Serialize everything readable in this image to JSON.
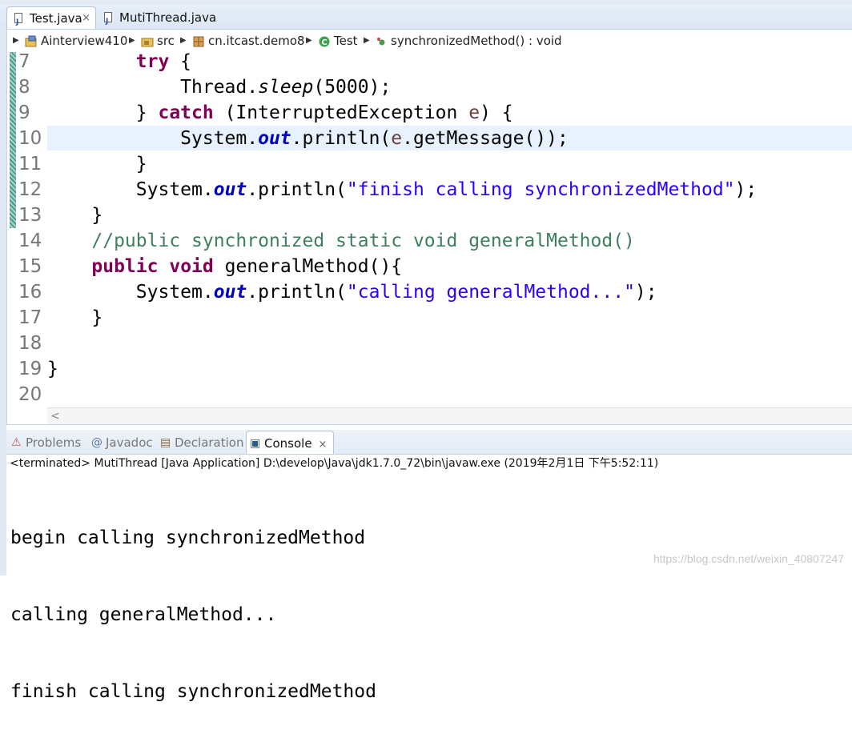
{
  "tabs": [
    {
      "label": "Test.java",
      "active": true,
      "closable": true
    },
    {
      "label": "MutiThread.java",
      "active": false,
      "closable": false
    }
  ],
  "close_glyph": "×",
  "breadcrumb": [
    {
      "label": "Ainterview410",
      "icon": "project-icon"
    },
    {
      "label": "src",
      "icon": "source-folder-icon"
    },
    {
      "label": "cn.itcast.demo8",
      "icon": "package-icon"
    },
    {
      "label": "Test",
      "icon": "class-icon"
    },
    {
      "label": "synchronizedMethod() : void",
      "icon": "method-icon"
    }
  ],
  "editor": {
    "highlighted_line": "10",
    "lines": [
      {
        "no": "7",
        "indent": "        ",
        "tokens": [
          {
            "t": "try",
            "c": "kw"
          },
          {
            "t": " {",
            "c": ""
          }
        ]
      },
      {
        "no": "8",
        "indent": "            ",
        "tokens": [
          {
            "t": "Thread.",
            "c": ""
          },
          {
            "t": "sleep",
            "c": "itl"
          },
          {
            "t": "(5000);",
            "c": ""
          }
        ]
      },
      {
        "no": "9",
        "indent": "        ",
        "tokens": [
          {
            "t": "} ",
            "c": ""
          },
          {
            "t": "catch",
            "c": "kw"
          },
          {
            "t": " (InterruptedException ",
            "c": ""
          },
          {
            "t": "e",
            "c": "var"
          },
          {
            "t": ") {",
            "c": ""
          }
        ]
      },
      {
        "no": "10",
        "indent": "            ",
        "tokens": [
          {
            "t": "System.",
            "c": ""
          },
          {
            "t": "out",
            "c": "fld"
          },
          {
            "t": ".println(",
            "c": ""
          },
          {
            "t": "e",
            "c": "var"
          },
          {
            "t": ".getMessage());",
            "c": ""
          }
        ]
      },
      {
        "no": "11",
        "indent": "        ",
        "tokens": [
          {
            "t": "}",
            "c": ""
          }
        ]
      },
      {
        "no": "12",
        "indent": "        ",
        "tokens": [
          {
            "t": "System.",
            "c": ""
          },
          {
            "t": "out",
            "c": "fld"
          },
          {
            "t": ".println(",
            "c": ""
          },
          {
            "t": "\"finish calling synchronizedMethod\"",
            "c": "str"
          },
          {
            "t": ");",
            "c": ""
          }
        ]
      },
      {
        "no": "13",
        "indent": "    ",
        "tokens": [
          {
            "t": "}",
            "c": ""
          }
        ]
      },
      {
        "no": "14",
        "indent": "    ",
        "tokens": [
          {
            "t": "//public synchronized static void generalMethod()",
            "c": "cmt"
          }
        ]
      },
      {
        "no": "15",
        "indent": "    ",
        "tokens": [
          {
            "t": "public",
            "c": "kw"
          },
          {
            "t": " ",
            "c": ""
          },
          {
            "t": "void",
            "c": "kw"
          },
          {
            "t": " generalMethod(){",
            "c": ""
          }
        ]
      },
      {
        "no": "16",
        "indent": "        ",
        "tokens": [
          {
            "t": "System.",
            "c": ""
          },
          {
            "t": "out",
            "c": "fld"
          },
          {
            "t": ".println(",
            "c": ""
          },
          {
            "t": "\"calling generalMethod...\"",
            "c": "str"
          },
          {
            "t": ");",
            "c": ""
          }
        ]
      },
      {
        "no": "17",
        "indent": "    ",
        "tokens": [
          {
            "t": "}",
            "c": ""
          }
        ]
      },
      {
        "no": "18",
        "indent": "",
        "tokens": []
      },
      {
        "no": "19",
        "indent": "",
        "tokens": [
          {
            "t": "}",
            "c": ""
          }
        ]
      },
      {
        "no": "20",
        "indent": "",
        "tokens": []
      }
    ]
  },
  "panel": {
    "tabs": [
      {
        "label": "Problems",
        "icon": "problems-icon",
        "active": false
      },
      {
        "label": "Javadoc",
        "icon": "javadoc-icon",
        "active": false
      },
      {
        "label": "Declaration",
        "icon": "declaration-icon",
        "active": false
      },
      {
        "label": "Console",
        "icon": "console-icon",
        "active": true
      }
    ],
    "status": "<terminated> MutiThread [Java Application] D:\\develop\\Java\\jdk1.7.0_72\\bin\\javaw.exe (2019年2月1日 下午5:52:11)",
    "output": [
      "begin calling synchronizedMethod",
      "calling generalMethod...",
      "finish calling synchronizedMethod"
    ]
  },
  "watermark": "https://blog.csdn.net/weixin_40807247",
  "colors": {
    "keyword": "#7f0055",
    "string": "#2a00ff",
    "comment": "#3f7f5f",
    "field": "#0000c0",
    "highlight": "#e8f2fe"
  }
}
